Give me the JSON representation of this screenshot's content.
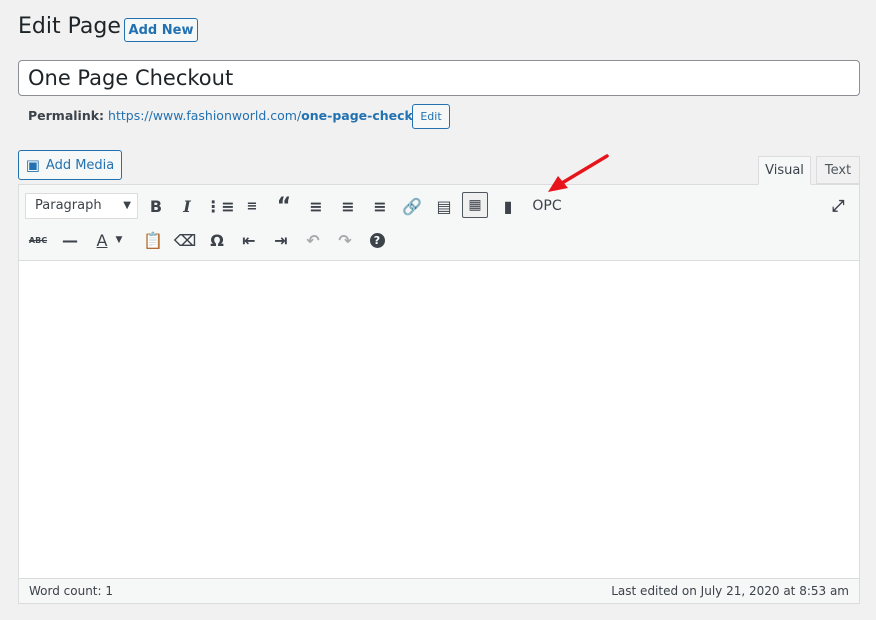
{
  "header": {
    "title": "Edit Page",
    "add_new": "Add New"
  },
  "post": {
    "title": "One Page Checkout"
  },
  "permalink": {
    "label": "Permalink:",
    "url_base": "https://www.fashionworld.com/",
    "slug": "one-page-checkout",
    "url_end": "/",
    "edit": "Edit"
  },
  "media": {
    "add_media": "Add Media"
  },
  "tabs": {
    "visual": "Visual",
    "text": "Text",
    "active": "Visual"
  },
  "toolbar": {
    "format": "Paragraph",
    "opc": "OPC",
    "icons_row1": [
      "bold-icon",
      "italic-icon",
      "bulleted-list-icon",
      "numbered-list-icon",
      "blockquote-icon",
      "align-left-icon",
      "align-center-icon",
      "align-right-icon",
      "link-icon",
      "read-more-icon",
      "toolbar-toggle-icon",
      "ticket-icon",
      "fullscreen-icon"
    ],
    "icons_row2": [
      "strikethrough-icon",
      "horizontal-line-icon",
      "text-color-icon",
      "paste-text-icon",
      "clear-formatting-icon",
      "special-character-icon",
      "outdent-icon",
      "indent-icon",
      "undo-icon",
      "redo-icon",
      "help-icon"
    ]
  },
  "status": {
    "word_count": "Word count: 1",
    "last_edited": "Last edited on July 21, 2020 at 8:53 am"
  },
  "annotation": {
    "arrow_color": "#e8141b"
  }
}
